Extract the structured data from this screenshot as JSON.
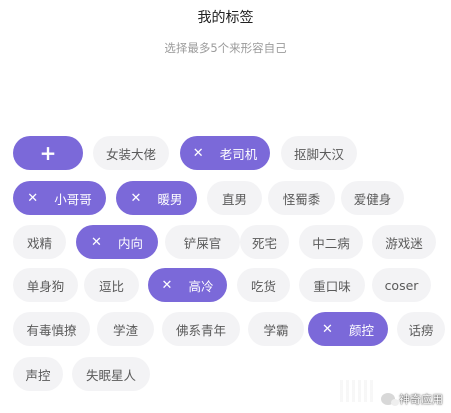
{
  "header": {
    "title": "我的标签",
    "subtitle": "选择最多5个来形容自己"
  },
  "add_chip": {
    "icon": "plus-icon",
    "symbol": "+"
  },
  "tags": [
    {
      "label": "女装大佬",
      "selected": false
    },
    {
      "label": "老司机",
      "selected": true
    },
    {
      "label": "抠脚大汉",
      "selected": false
    },
    {
      "label": "小哥哥",
      "selected": true
    },
    {
      "label": "暖男",
      "selected": true
    },
    {
      "label": "直男",
      "selected": false
    },
    {
      "label": "怪蜀黍",
      "selected": false
    },
    {
      "label": "爱健身",
      "selected": false
    },
    {
      "label": "戏精",
      "selected": false
    },
    {
      "label": "内向",
      "selected": true
    },
    {
      "label": "铲屎官",
      "selected": false
    },
    {
      "label": "死宅",
      "selected": false
    },
    {
      "label": "中二病",
      "selected": false
    },
    {
      "label": "游戏迷",
      "selected": false
    },
    {
      "label": "单身狗",
      "selected": false
    },
    {
      "label": "逗比",
      "selected": false
    },
    {
      "label": "高冷",
      "selected": true
    },
    {
      "label": "吃货",
      "selected": false
    },
    {
      "label": "重口味",
      "selected": false
    },
    {
      "label": "coser",
      "selected": false
    },
    {
      "label": "有毒慎撩",
      "selected": false
    },
    {
      "label": "学渣",
      "selected": false
    },
    {
      "label": "佛系青年",
      "selected": false
    },
    {
      "label": "学霸",
      "selected": false
    },
    {
      "label": "颜控",
      "selected": true
    },
    {
      "label": "话痨",
      "selected": false
    },
    {
      "label": "声控",
      "selected": false
    },
    {
      "label": "失眠星人",
      "selected": false
    }
  ],
  "remove_symbol": "✕",
  "colors": {
    "accent": "#7b69d9",
    "chip_bg": "#f3f3f5",
    "chip_text": "#5a5a5a"
  },
  "watermark": {
    "text": "神奇应用",
    "icon": "wechat-icon"
  }
}
